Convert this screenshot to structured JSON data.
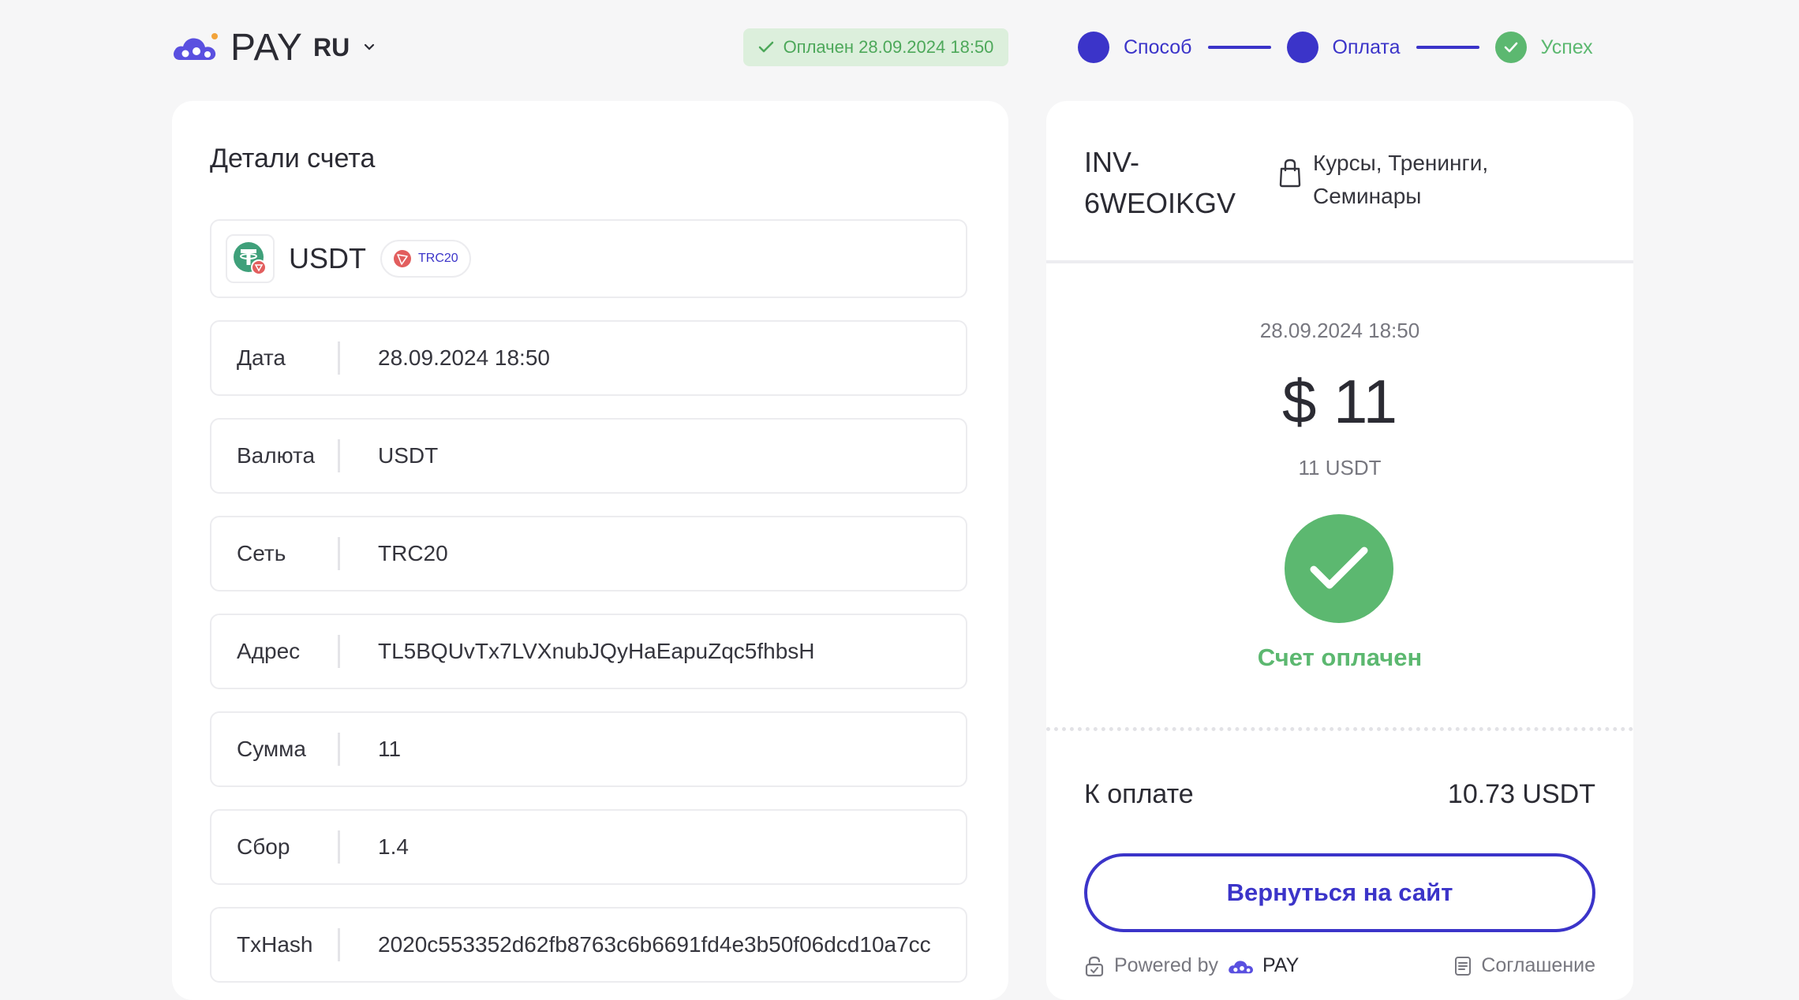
{
  "header": {
    "logo_text": "PAY",
    "language": "RU",
    "status_badge": "Оплачен 28.09.2024 18:50",
    "steps": [
      {
        "label": "Способ",
        "state": "active"
      },
      {
        "label": "Оплата",
        "state": "active"
      },
      {
        "label": "Успех",
        "state": "done"
      }
    ]
  },
  "details": {
    "title": "Детали счета",
    "coin": {
      "name": "USDT",
      "network": "TRC20"
    },
    "rows": [
      {
        "key": "Дата",
        "value": "28.09.2024 18:50"
      },
      {
        "key": "Валюта",
        "value": "USDT"
      },
      {
        "key": "Сеть",
        "value": "TRC20"
      },
      {
        "key": "Адрес",
        "value": "TL5BQUvTx7LVXnubJQyHaEapuZqc5fhbsH"
      },
      {
        "key": "Сумма",
        "value": "11"
      },
      {
        "key": "Сбор",
        "value": "1.4"
      },
      {
        "key": "TxHash",
        "value": "2020c553352d62fb8763c6b6691fd4e3b50f06dcd10a7cc"
      }
    ]
  },
  "invoice": {
    "id": "INV-6WEOIKGV",
    "category": "Курсы, Тренинги, Семинары",
    "date": "28.09.2024 18:50",
    "amount": "$ 11",
    "crypto_amount": "11 USDT",
    "status_text": "Счет оплачен",
    "due_label": "К оплате",
    "due_value": "10.73 USDT",
    "return_button": "Вернуться на сайт",
    "powered_by": "Powered by",
    "powered_brand": "PAY",
    "agreement": "Соглашение"
  },
  "colors": {
    "primary": "#3b34c9",
    "success": "#5cb870",
    "background": "#f6f6f7"
  }
}
